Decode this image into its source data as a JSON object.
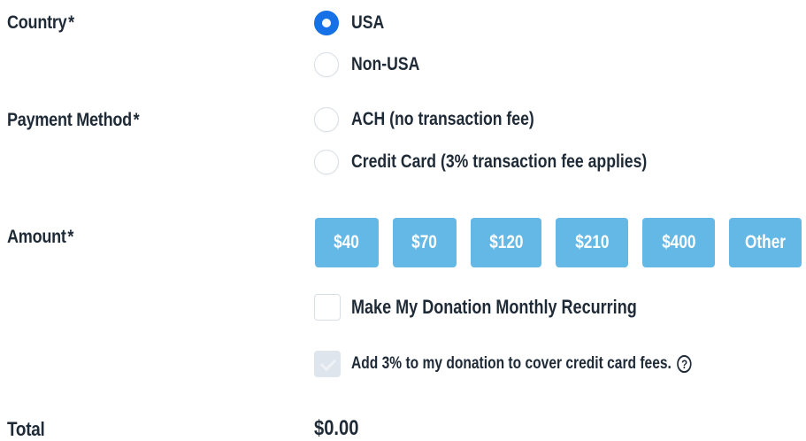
{
  "fields": {
    "country": {
      "label": "Country",
      "required_mark": "*",
      "options": [
        {
          "label": "USA",
          "selected": true
        },
        {
          "label": "Non-USA",
          "selected": false
        }
      ]
    },
    "payment_method": {
      "label": "Payment Method",
      "required_mark": "*",
      "options": [
        {
          "label": "ACH (no transaction fee)",
          "selected": false
        },
        {
          "label": "Credit Card (3% transaction fee applies)",
          "selected": false
        }
      ]
    },
    "amount": {
      "label": "Amount",
      "required_mark": "*",
      "buttons": [
        "$40",
        "$70",
        "$120",
        "$210",
        "$400",
        "Other"
      ]
    },
    "recurring": {
      "label": "Make My Donation Monthly Recurring",
      "checked": false
    },
    "cover_fees": {
      "label": "Add 3% to my donation to cover credit card fees.",
      "checked": true,
      "disabled": true,
      "help_icon": "question-circle-icon",
      "help_glyph": "?"
    },
    "total": {
      "label": "Total",
      "value": "$0.00"
    }
  },
  "colors": {
    "text": "#1f2a37",
    "radio_selected": "#1670e6",
    "amount_button": "#64b8e6",
    "disabled_checkbox": "#dfe5ec"
  }
}
